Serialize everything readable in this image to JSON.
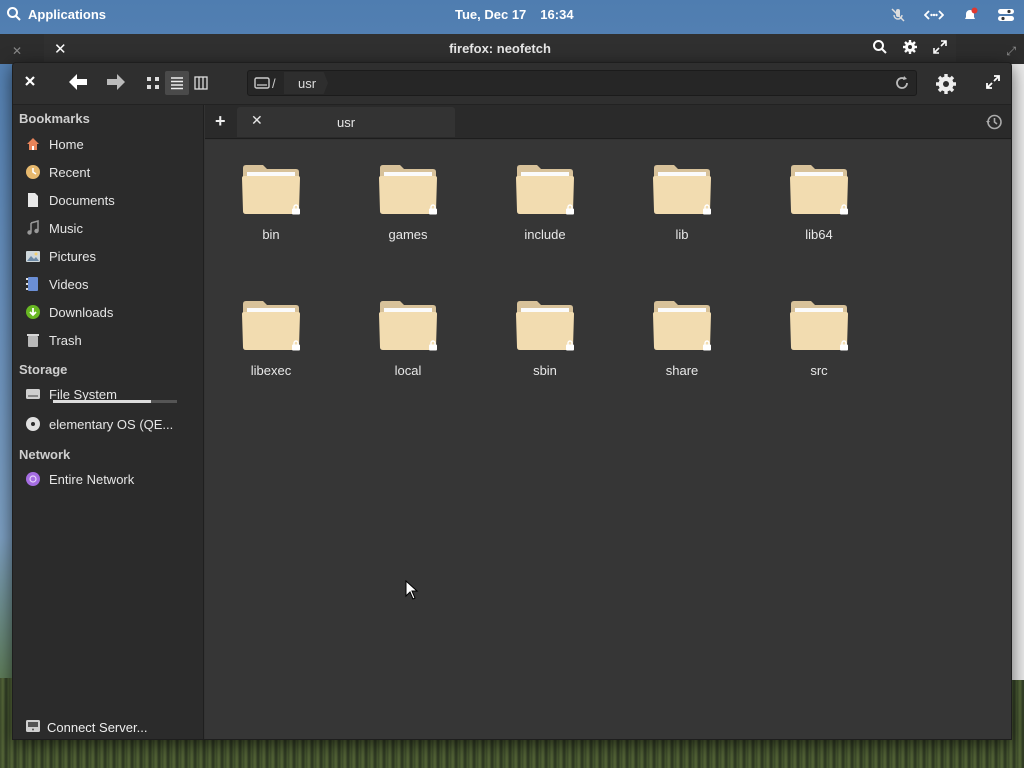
{
  "top_panel": {
    "applications_label": "Applications",
    "date": "Tue, Dec 17",
    "time": "16:34"
  },
  "background_window": {
    "title": "firefox: neofetch"
  },
  "files": {
    "path": {
      "root": "/",
      "crumb": "usr"
    },
    "tab": {
      "label": "usr"
    },
    "sidebar": {
      "bookmarks_header": "Bookmarks",
      "bookmarks": [
        {
          "label": "Home",
          "icon": "home-icon"
        },
        {
          "label": "Recent",
          "icon": "recent-icon"
        },
        {
          "label": "Documents",
          "icon": "documents-icon"
        },
        {
          "label": "Music",
          "icon": "music-icon"
        },
        {
          "label": "Pictures",
          "icon": "pictures-icon"
        },
        {
          "label": "Videos",
          "icon": "videos-icon"
        },
        {
          "label": "Downloads",
          "icon": "downloads-icon"
        },
        {
          "label": "Trash",
          "icon": "trash-icon"
        }
      ],
      "storage_header": "Storage",
      "storage": [
        {
          "label": "File System",
          "icon": "drive-icon",
          "usage": 0.79
        },
        {
          "label": "elementary OS (QE...",
          "icon": "disc-icon"
        }
      ],
      "network_header": "Network",
      "network": [
        {
          "label": "Entire Network",
          "icon": "network-icon"
        }
      ],
      "connect_label": "Connect Server..."
    },
    "folders": [
      "bin",
      "games",
      "include",
      "lib",
      "lib64",
      "libexec",
      "local",
      "sbin",
      "share",
      "src"
    ]
  }
}
